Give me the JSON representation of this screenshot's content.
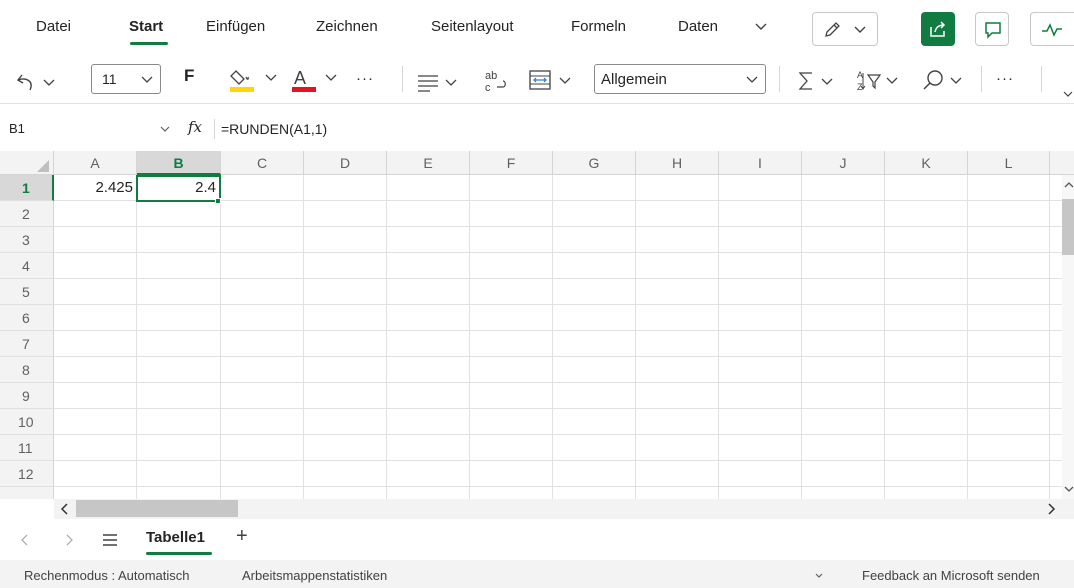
{
  "menu": {
    "tabs": [
      "Datei",
      "Start",
      "Einfügen",
      "Zeichnen",
      "Seitenlayout",
      "Formeln",
      "Daten"
    ],
    "active": "Start"
  },
  "ribbon": {
    "font_size": "11",
    "bold_label": "F",
    "number_format": "Allgemein",
    "more": "···"
  },
  "formula_bar": {
    "name_box": "B1",
    "fx_label": "fx",
    "formula": "=RUNDEN(A1,1)"
  },
  "grid": {
    "columns": [
      "A",
      "B",
      "C",
      "D",
      "E",
      "F",
      "G",
      "H",
      "I",
      "J",
      "K",
      "L"
    ],
    "rows": [
      "1",
      "2",
      "3",
      "4",
      "5",
      "6",
      "7",
      "8",
      "9",
      "10",
      "11",
      "12"
    ],
    "selected_column": "B",
    "selected_row": "1",
    "cells": {
      "A1": "2.425",
      "B1": "2.4"
    }
  },
  "sheets": {
    "tabs": [
      "Tabelle1"
    ],
    "active": "Tabelle1",
    "add_label": "+"
  },
  "status_bar": {
    "calc_mode": "Rechenmodus : Automatisch",
    "workbook_stats": "Arbeitsmappenstatistiken",
    "feedback": "Feedback an Microsoft senden"
  },
  "colors": {
    "accent": "#107c41",
    "highlight": "#ffd700",
    "font_color": "#e81123"
  }
}
